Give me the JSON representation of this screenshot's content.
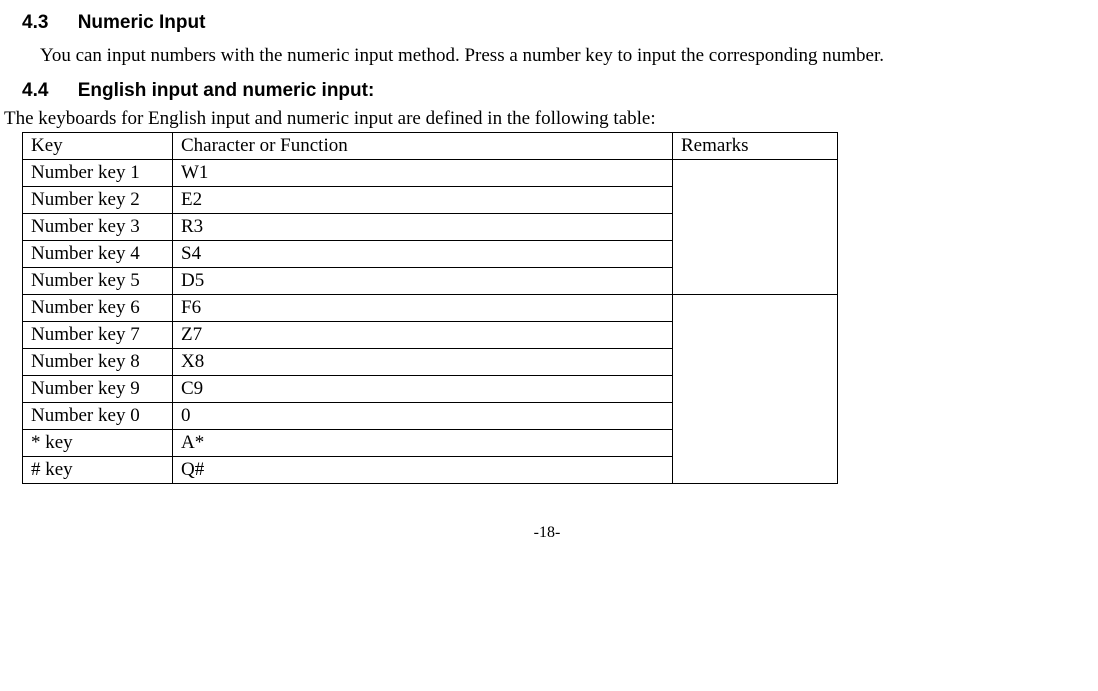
{
  "section43": {
    "number": "4.3",
    "title": "Numeric Input",
    "body": "You can input numbers with the numeric input method. Press a number key to input the corresponding number."
  },
  "section44": {
    "number": "4.4",
    "title": "English input and numeric input:",
    "intro": "The keyboards for English input and numeric input are defined in the following table:"
  },
  "table": {
    "headers": {
      "key": "Key",
      "char": "Character or Function",
      "rem": "Remarks"
    },
    "rows": [
      {
        "key": "Number key 1",
        "char": "W1"
      },
      {
        "key": "Number key 2",
        "char": "E2"
      },
      {
        "key": "Number key 3",
        "char": "R3"
      },
      {
        "key": "Number key 4",
        "char": "S4"
      },
      {
        "key": "Number key 5",
        "char": "D5"
      },
      {
        "key": "Number key 6",
        "char": "F6"
      },
      {
        "key": "Number key 7",
        "char": "Z7"
      },
      {
        "key": "Number key 8",
        "char": "X8"
      },
      {
        "key": "Number key 9",
        "char": "C9"
      },
      {
        "key": "Number key 0",
        "char": "0"
      },
      {
        "key": "* key",
        "char": "A*"
      },
      {
        "key": "# key",
        "char": "Q#"
      }
    ],
    "remarks_group1_span": 5,
    "remarks_group2_span": 7
  },
  "footer": "-18-"
}
